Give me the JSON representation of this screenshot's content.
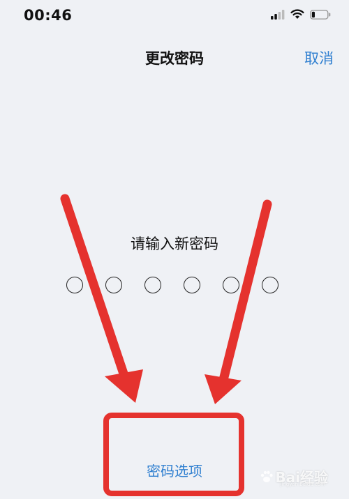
{
  "status_bar": {
    "time": "00:46",
    "signal_icon": "signal-icon",
    "wifi_icon": "wifi-icon",
    "battery_icon": "battery-icon",
    "battery_level": 0.2
  },
  "nav": {
    "title": "更改密码",
    "cancel_label": "取消"
  },
  "passcode": {
    "prompt": "请输入新密码",
    "digit_count": 6,
    "digits_entered": 0
  },
  "options_link": "密码选项",
  "annotations": {
    "color": "#e5322e",
    "arrow_icons": [
      "arrow-left-icon",
      "arrow-right-icon"
    ]
  },
  "watermark": {
    "text": "Bai经验",
    "small_text": "jingyan.baidu.com"
  },
  "colors": {
    "background": "#eff1f5",
    "accent": "#2f7fd0",
    "annotation": "#e5322e"
  }
}
